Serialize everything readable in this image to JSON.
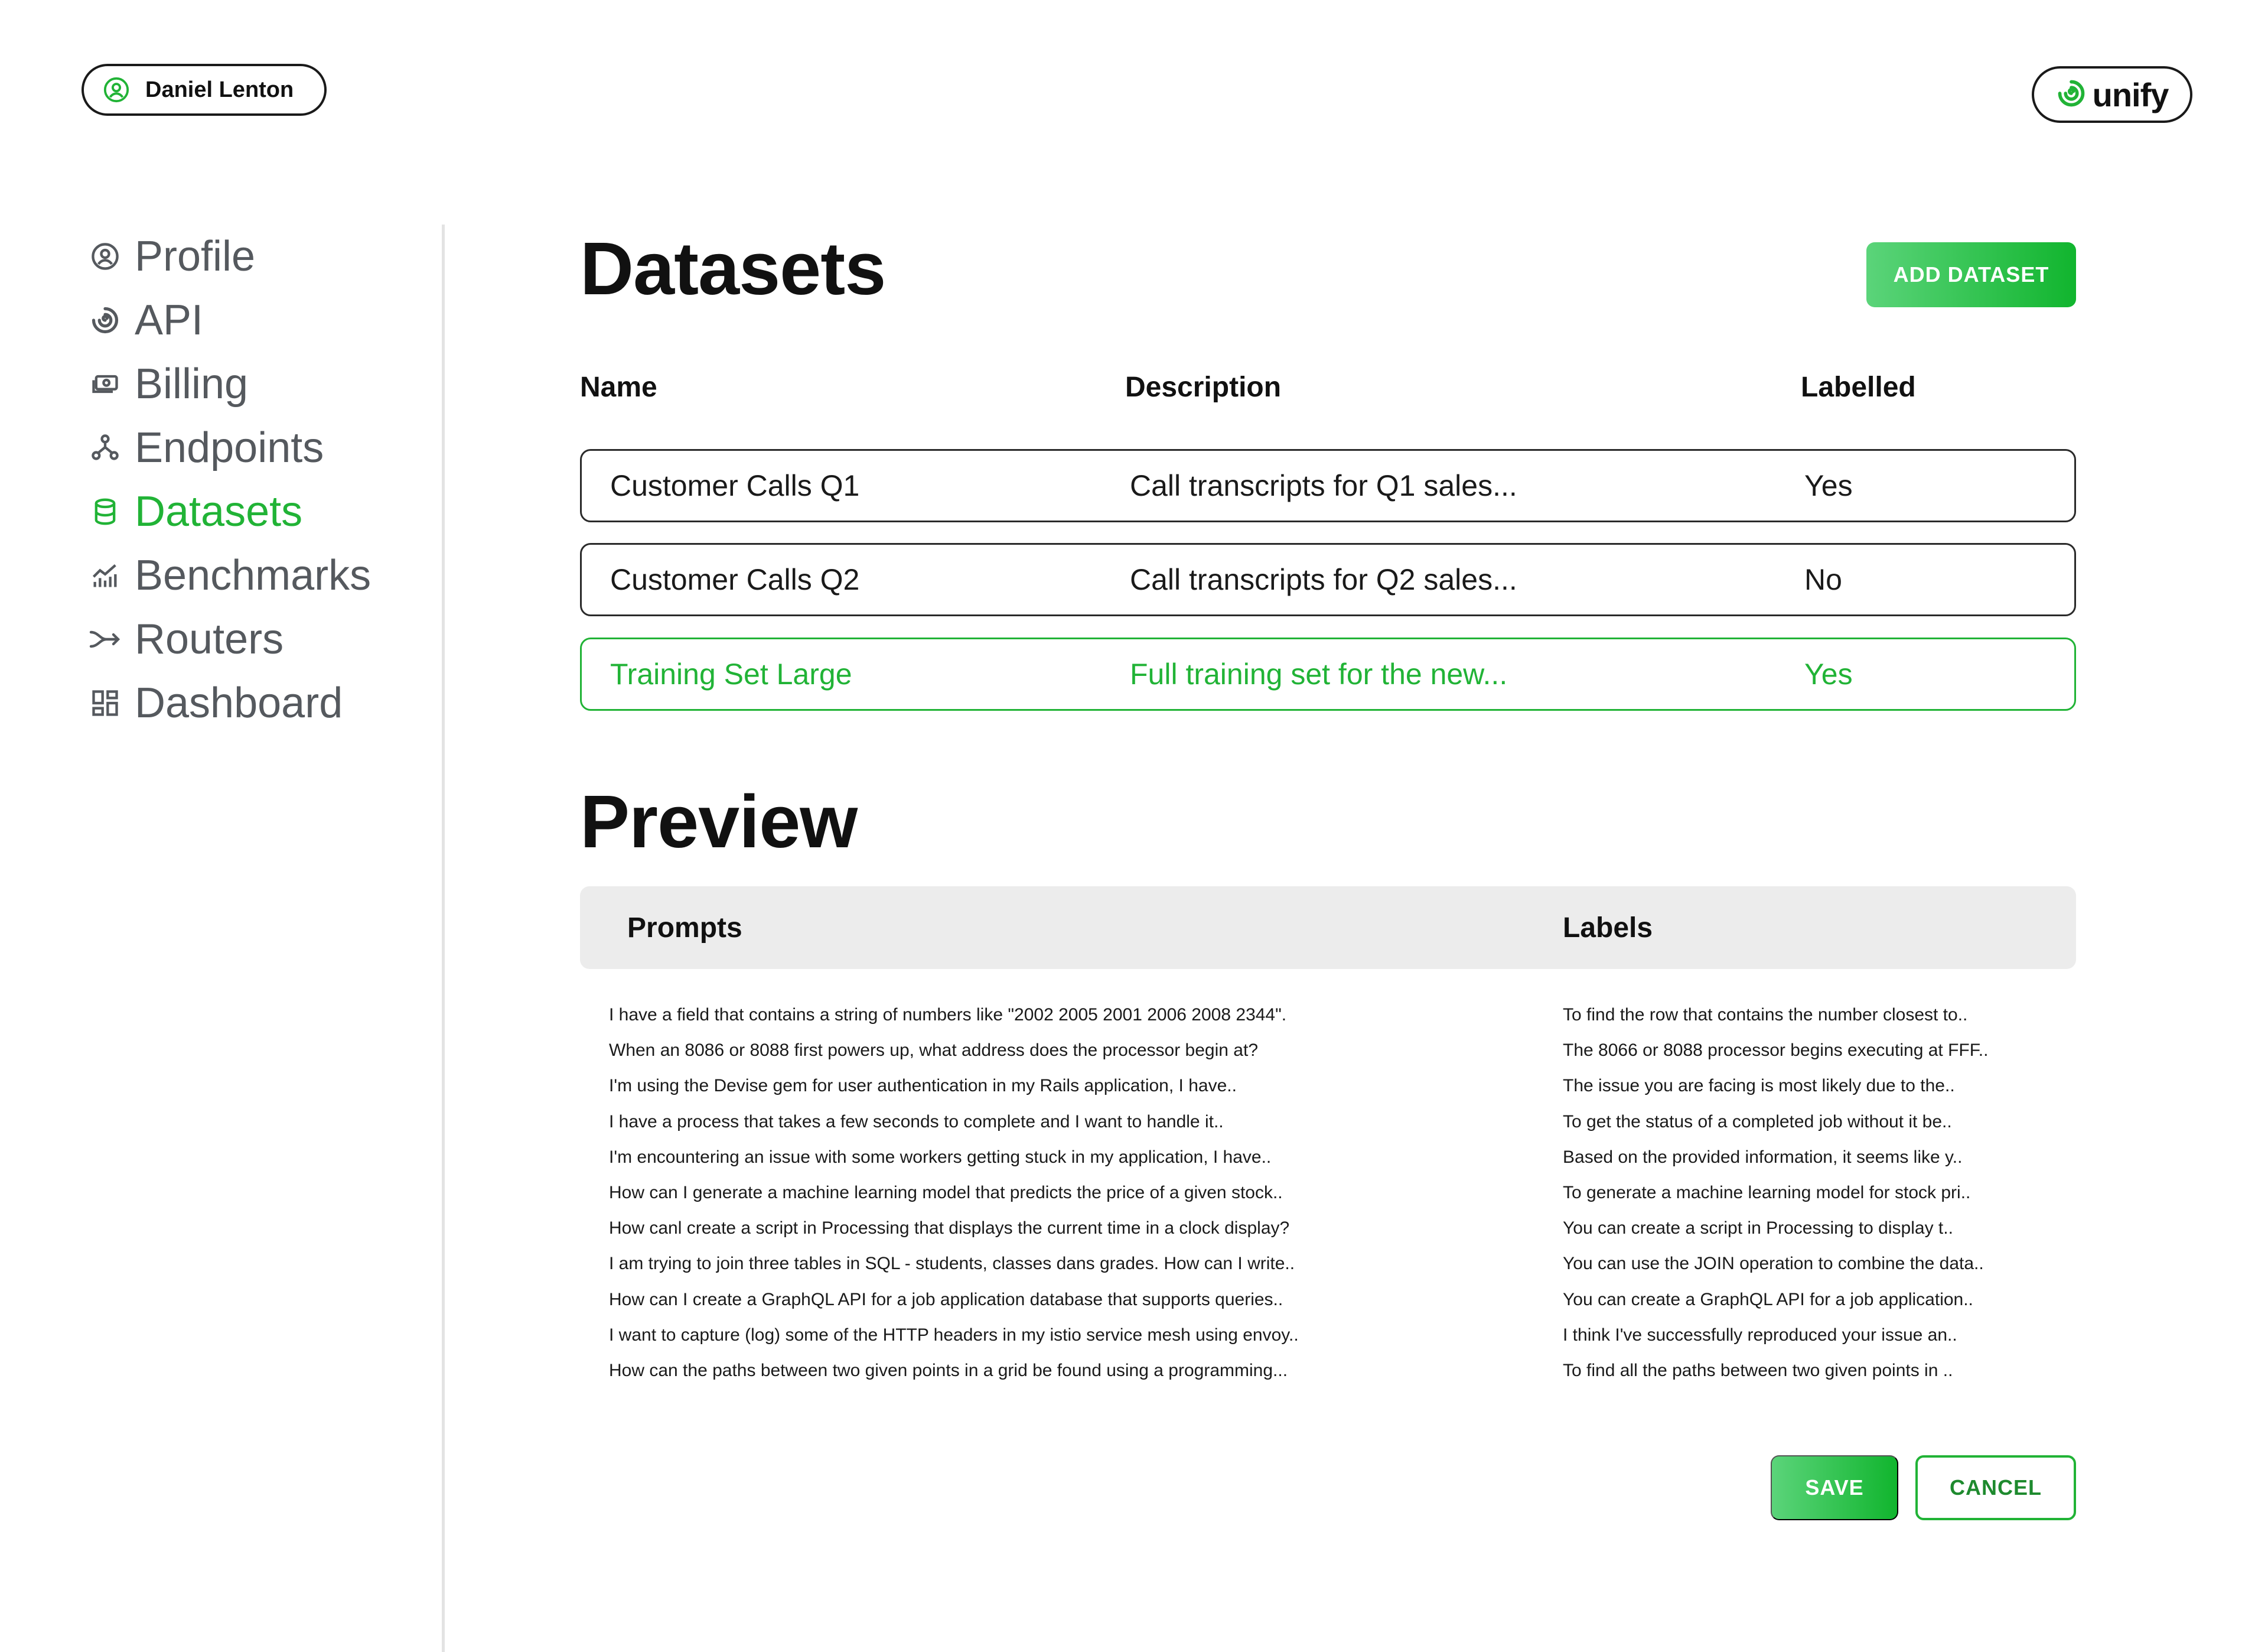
{
  "user": {
    "name": "Daniel Lenton",
    "icon": "user-circle-icon"
  },
  "brand": {
    "name": "unify",
    "icon": "swirl-logo-icon",
    "color": "#21b336"
  },
  "sidebar": {
    "items": [
      {
        "label": "Profile",
        "icon": "user-circle-icon",
        "active": false
      },
      {
        "label": "API",
        "icon": "swirl-icon",
        "active": false
      },
      {
        "label": "Billing",
        "icon": "money-icon",
        "active": false
      },
      {
        "label": "Endpoints",
        "icon": "network-icon",
        "active": false
      },
      {
        "label": "Datasets",
        "icon": "database-icon",
        "active": true
      },
      {
        "label": "Benchmarks",
        "icon": "chart-icon",
        "active": false
      },
      {
        "label": "Routers",
        "icon": "route-icon",
        "active": false
      },
      {
        "label": "Dashboard",
        "icon": "grid-icon",
        "active": false
      }
    ]
  },
  "datasets": {
    "title": "Datasets",
    "add_label": "ADD DATASET",
    "columns": {
      "name": "Name",
      "description": "Description",
      "labelled": "Labelled"
    },
    "rows": [
      {
        "name": "Customer Calls Q1",
        "description": "Call transcripts for Q1 sales...",
        "labelled": "Yes",
        "selected": false
      },
      {
        "name": "Customer Calls Q2",
        "description": "Call transcripts for Q2 sales...",
        "labelled": "No",
        "selected": false
      },
      {
        "name": "Training Set Large",
        "description": "Full training set for the new...",
        "labelled": "Yes",
        "selected": true
      }
    ]
  },
  "preview": {
    "title": "Preview",
    "columns": {
      "prompts": "Prompts",
      "labels": "Labels"
    },
    "prompts": [
      "I have a field that contains a string of numbers like \"2002 2005 2001 2006 2008 2344\".",
      "When an 8086 or 8088 first powers up, what address does the processor begin at?",
      "I'm using the Devise gem for user authentication in my Rails application, I have..",
      "I have a process that takes a few seconds to complete and I want to handle it..",
      "I'm encountering an issue with some workers getting stuck in my application, I have..",
      "How can I generate a machine learning model that predicts the price of a given stock..",
      "How canl create a script in Processing that displays the current time in a clock display?",
      "I am trying to join three tables in SQL - students, classes dans grades. How can I write..",
      "How can I create a GraphQL API for a job application database that supports queries..",
      "I want to capture (log) some of the HTTP headers in my istio service mesh using envoy..",
      "How can the paths between two given points in a grid be found using a programming..."
    ],
    "labels": [
      "To find the row that contains the number closest to..",
      "The 8066 or 8088 processor begins executing at FFF..",
      "The issue you are facing is most likely due to the..",
      "To get the status of a completed job without it be..",
      "Based on the provided information, it seems like y..",
      "To generate a machine learning model for stock pri..",
      "You can create a script in Processing to display t..",
      "You can use the JOIN operation to combine the data..",
      "You can create a GraphQL API for a job application..",
      "I think I've successfully reproduced your issue an..",
      "To find all the paths between two given points in .."
    ]
  },
  "actions": {
    "save_label": "SAVE",
    "cancel_label": "CANCEL"
  }
}
